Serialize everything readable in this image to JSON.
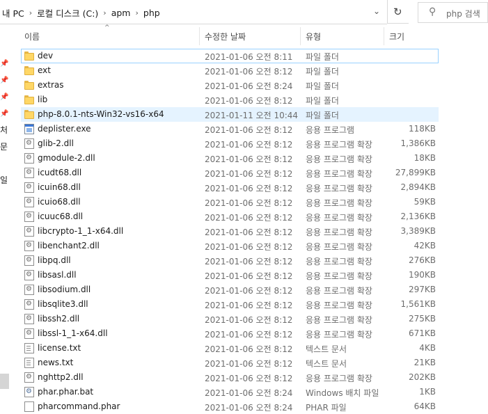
{
  "address": {
    "crumbs": [
      "내 PC",
      "로컬 디스크 (C:)",
      "apm",
      "php"
    ],
    "separator": "›"
  },
  "search": {
    "placeholder": "php 검색"
  },
  "nav": {
    "labels": [
      "처",
      "문",
      "일"
    ]
  },
  "columns": {
    "name": "이름",
    "date": "수정한 날짜",
    "type": "유형",
    "size": "크기"
  },
  "files": [
    {
      "name": "dev",
      "date": "2021-01-06 오전 8:11",
      "type": "파일 폴더",
      "size": "",
      "icon": "folder-icon"
    },
    {
      "name": "ext",
      "date": "2021-01-06 오전 8:12",
      "type": "파일 폴더",
      "size": "",
      "icon": "folder-icon"
    },
    {
      "name": "extras",
      "date": "2021-01-06 오전 8:24",
      "type": "파일 폴더",
      "size": "",
      "icon": "folder-icon"
    },
    {
      "name": "lib",
      "date": "2021-01-06 오전 8:12",
      "type": "파일 폴더",
      "size": "",
      "icon": "folder-icon"
    },
    {
      "name": "php-8.0.1-nts-Win32-vs16-x64",
      "date": "2021-01-11 오전 10:44",
      "type": "파일 폴더",
      "size": "",
      "icon": "folder-icon"
    },
    {
      "name": "deplister.exe",
      "date": "2021-01-06 오전 8:12",
      "type": "응용 프로그램",
      "size": "118KB",
      "icon": "exe-icon"
    },
    {
      "name": "glib-2.dll",
      "date": "2021-01-06 오전 8:12",
      "type": "응용 프로그램 확장",
      "size": "1,386KB",
      "icon": "dll-icon"
    },
    {
      "name": "gmodule-2.dll",
      "date": "2021-01-06 오전 8:12",
      "type": "응용 프로그램 확장",
      "size": "18KB",
      "icon": "dll-icon"
    },
    {
      "name": "icudt68.dll",
      "date": "2021-01-06 오전 8:12",
      "type": "응용 프로그램 확장",
      "size": "27,899KB",
      "icon": "dll-icon"
    },
    {
      "name": "icuin68.dll",
      "date": "2021-01-06 오전 8:12",
      "type": "응용 프로그램 확장",
      "size": "2,894KB",
      "icon": "dll-icon"
    },
    {
      "name": "icuio68.dll",
      "date": "2021-01-06 오전 8:12",
      "type": "응용 프로그램 확장",
      "size": "59KB",
      "icon": "dll-icon"
    },
    {
      "name": "icuuc68.dll",
      "date": "2021-01-06 오전 8:12",
      "type": "응용 프로그램 확장",
      "size": "2,136KB",
      "icon": "dll-icon"
    },
    {
      "name": "libcrypto-1_1-x64.dll",
      "date": "2021-01-06 오전 8:12",
      "type": "응용 프로그램 확장",
      "size": "3,389KB",
      "icon": "dll-icon"
    },
    {
      "name": "libenchant2.dll",
      "date": "2021-01-06 오전 8:12",
      "type": "응용 프로그램 확장",
      "size": "42KB",
      "icon": "dll-icon"
    },
    {
      "name": "libpq.dll",
      "date": "2021-01-06 오전 8:12",
      "type": "응용 프로그램 확장",
      "size": "276KB",
      "icon": "dll-icon"
    },
    {
      "name": "libsasl.dll",
      "date": "2021-01-06 오전 8:12",
      "type": "응용 프로그램 확장",
      "size": "190KB",
      "icon": "dll-icon"
    },
    {
      "name": "libsodium.dll",
      "date": "2021-01-06 오전 8:12",
      "type": "응용 프로그램 확장",
      "size": "297KB",
      "icon": "dll-icon"
    },
    {
      "name": "libsqlite3.dll",
      "date": "2021-01-06 오전 8:12",
      "type": "응용 프로그램 확장",
      "size": "1,561KB",
      "icon": "dll-icon"
    },
    {
      "name": "libssh2.dll",
      "date": "2021-01-06 오전 8:12",
      "type": "응용 프로그램 확장",
      "size": "275KB",
      "icon": "dll-icon"
    },
    {
      "name": "libssl-1_1-x64.dll",
      "date": "2021-01-06 오전 8:12",
      "type": "응용 프로그램 확장",
      "size": "671KB",
      "icon": "dll-icon"
    },
    {
      "name": "license.txt",
      "date": "2021-01-06 오전 8:12",
      "type": "텍스트 문서",
      "size": "4KB",
      "icon": "text-file-icon"
    },
    {
      "name": "news.txt",
      "date": "2021-01-06 오전 8:12",
      "type": "텍스트 문서",
      "size": "21KB",
      "icon": "text-file-icon"
    },
    {
      "name": "nghttp2.dll",
      "date": "2021-01-06 오전 8:12",
      "type": "응용 프로그램 확장",
      "size": "202KB",
      "icon": "dll-icon"
    },
    {
      "name": "phar.phar.bat",
      "date": "2021-01-06 오전 8:24",
      "type": "Windows 배치 파일",
      "size": "1KB",
      "icon": "batch-file-icon"
    },
    {
      "name": "pharcommand.phar",
      "date": "2021-01-06 오전 8:24",
      "type": "PHAR 파일",
      "size": "64KB",
      "icon": "file-icon"
    }
  ],
  "state": {
    "focused_row": 0,
    "hovered_row": 4
  },
  "colors": {
    "focus_border": "#99d1ff",
    "hover_bg": "#e5f3ff",
    "folder": "#ffd766"
  }
}
